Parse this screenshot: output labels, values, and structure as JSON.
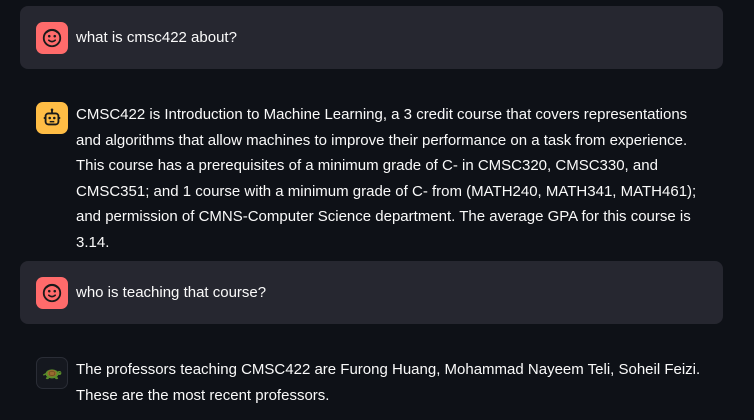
{
  "messages": [
    {
      "role": "user",
      "avatar_icon": "smiling-face-icon",
      "text": "what is cmsc422 about?"
    },
    {
      "role": "assistant",
      "avatar_icon": "robot-icon",
      "text": "CMSC422 is Introduction to Machine Learning, a 3 credit course that covers representations and algorithms that allow machines to improve their performance on a task from experience. This course has a prerequisites of a minimum grade of C- in CMSC320, CMSC330, and CMSC351; and 1 course with a minimum grade of C- from (MATH240, MATH341, MATH461); and permission of CMNS-Computer Science department. The average GPA for this course is 3.14."
    },
    {
      "role": "user",
      "avatar_icon": "smiling-face-icon",
      "text": "who is teaching that course?"
    },
    {
      "role": "assistant",
      "avatar_icon": "turtle-icon",
      "text": "The professors teaching CMSC422 are Furong Huang, Mohammad Nayeem Teli, Soheil Feizi. These are the most recent professors."
    }
  ],
  "colors": {
    "background": "#0e1117",
    "user_bubble": "#262730",
    "user_avatar": "#ff6b6b",
    "bot_avatar": "#ffbd45",
    "text": "#fafafa"
  }
}
